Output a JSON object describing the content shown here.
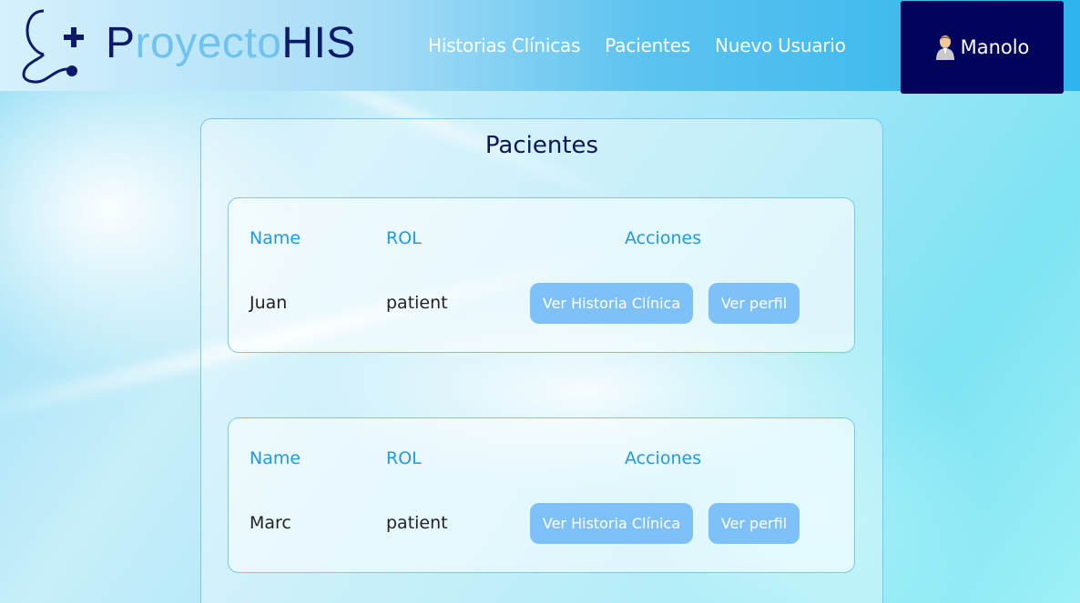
{
  "brand": {
    "part1": "P",
    "part2": "royecto",
    "part3": "HIS",
    "icon": "stethoscope-plus-icon"
  },
  "nav": {
    "items": [
      {
        "label": "Historias Clínicas"
      },
      {
        "label": "Pacientes"
      },
      {
        "label": "Nuevo Usuario"
      }
    ]
  },
  "user": {
    "name": "Manolo",
    "icon": "user-avatar-icon"
  },
  "page": {
    "title": "Pacientes"
  },
  "table_headers": {
    "name": "Name",
    "rol": "ROL",
    "acciones": "Acciones"
  },
  "patients": [
    {
      "name": "Juan",
      "rol": "patient",
      "history_button": "Ver Historia Clínica",
      "profile_button": "Ver perfil"
    },
    {
      "name": "Marc",
      "rol": "patient",
      "history_button": "Ver Historia Clínica",
      "profile_button": "Ver perfil"
    }
  ],
  "colors": {
    "header_dark": "#02035c",
    "brand_dark": "#0c1a6b",
    "brand_light": "#6fc3ee",
    "accent_text": "#1e9be0",
    "button": "#7ec1f9",
    "border": "#7cc6f4"
  }
}
